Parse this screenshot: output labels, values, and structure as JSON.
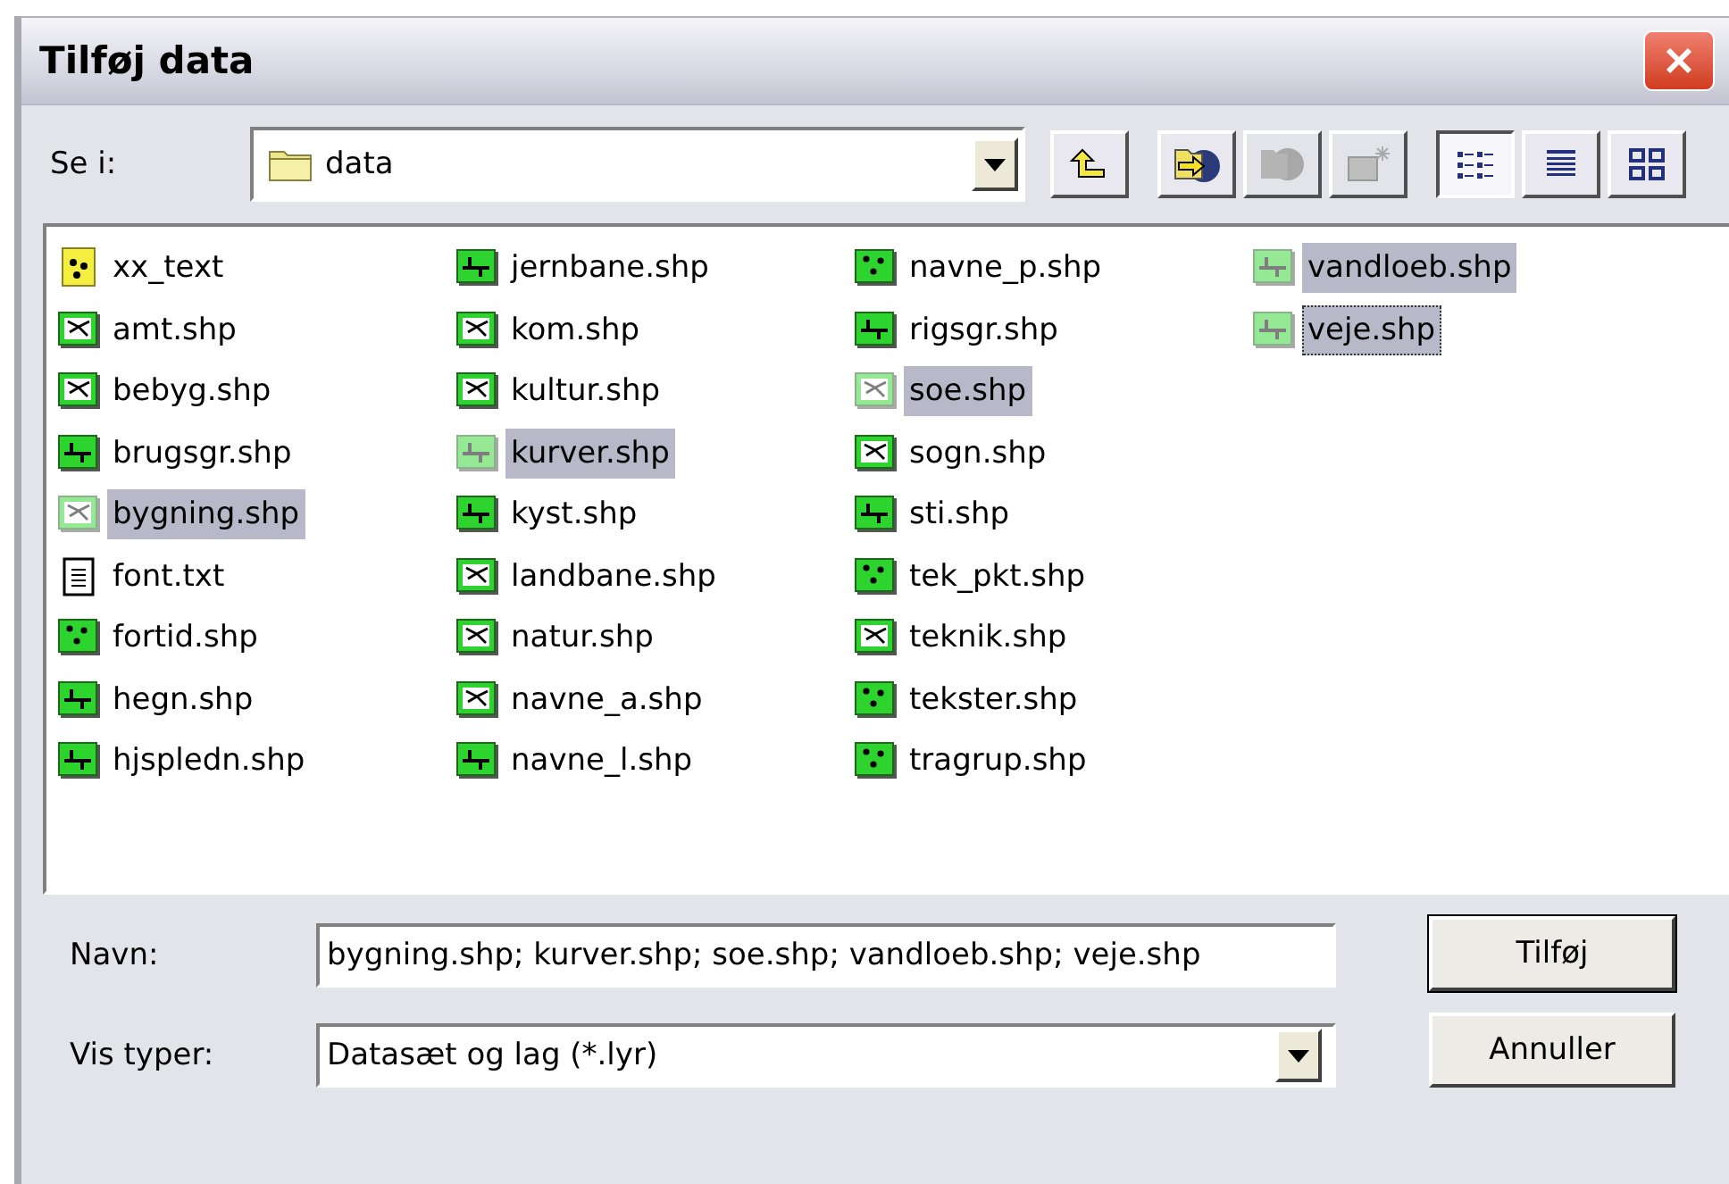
{
  "window": {
    "title": "Tilføj data"
  },
  "look_in": {
    "label": "Se i:",
    "value": "data"
  },
  "toolbar": [
    {
      "kind": "up",
      "disabled": false,
      "selected": false
    },
    {
      "kind": "connect",
      "disabled": false,
      "selected": false
    },
    {
      "kind": "disconnect",
      "disabled": true,
      "selected": false
    },
    {
      "kind": "new",
      "disabled": true,
      "selected": false
    },
    {
      "kind": "list",
      "disabled": false,
      "selected": true
    },
    {
      "kind": "details",
      "disabled": false,
      "selected": false
    },
    {
      "kind": "thumbnails",
      "disabled": false,
      "selected": false
    }
  ],
  "files": [
    {
      "name": "xx_text",
      "kind": "layer",
      "selected": false,
      "focused": false
    },
    {
      "name": "amt.shp",
      "kind": "polygon",
      "selected": false,
      "focused": false
    },
    {
      "name": "bebyg.shp",
      "kind": "polygon",
      "selected": false,
      "focused": false
    },
    {
      "name": "brugsgr.shp",
      "kind": "line",
      "selected": false,
      "focused": false
    },
    {
      "name": "bygning.shp",
      "kind": "polygon",
      "selected": true,
      "focused": false
    },
    {
      "name": "font.txt",
      "kind": "text",
      "selected": false,
      "focused": false
    },
    {
      "name": "fortid.shp",
      "kind": "point",
      "selected": false,
      "focused": false
    },
    {
      "name": "hegn.shp",
      "kind": "line",
      "selected": false,
      "focused": false
    },
    {
      "name": "hjspledn.shp",
      "kind": "line",
      "selected": false,
      "focused": false
    },
    {
      "name": "jernbane.shp",
      "kind": "line",
      "selected": false,
      "focused": false
    },
    {
      "name": "kom.shp",
      "kind": "polygon",
      "selected": false,
      "focused": false
    },
    {
      "name": "kultur.shp",
      "kind": "polygon",
      "selected": false,
      "focused": false
    },
    {
      "name": "kurver.shp",
      "kind": "line",
      "selected": true,
      "focused": false
    },
    {
      "name": "kyst.shp",
      "kind": "line",
      "selected": false,
      "focused": false
    },
    {
      "name": "landbane.shp",
      "kind": "polygon",
      "selected": false,
      "focused": false
    },
    {
      "name": "natur.shp",
      "kind": "polygon",
      "selected": false,
      "focused": false
    },
    {
      "name": "navne_a.shp",
      "kind": "polygon",
      "selected": false,
      "focused": false
    },
    {
      "name": "navne_l.shp",
      "kind": "line",
      "selected": false,
      "focused": false
    },
    {
      "name": "navne_p.shp",
      "kind": "point",
      "selected": false,
      "focused": false
    },
    {
      "name": "rigsgr.shp",
      "kind": "line",
      "selected": false,
      "focused": false
    },
    {
      "name": "soe.shp",
      "kind": "polygon",
      "selected": true,
      "focused": false
    },
    {
      "name": "sogn.shp",
      "kind": "polygon",
      "selected": false,
      "focused": false
    },
    {
      "name": "sti.shp",
      "kind": "line",
      "selected": false,
      "focused": false
    },
    {
      "name": "tek_pkt.shp",
      "kind": "point",
      "selected": false,
      "focused": false
    },
    {
      "name": "teknik.shp",
      "kind": "polygon",
      "selected": false,
      "focused": false
    },
    {
      "name": "tekster.shp",
      "kind": "point",
      "selected": false,
      "focused": false
    },
    {
      "name": "tragrup.shp",
      "kind": "point",
      "selected": false,
      "focused": false
    },
    {
      "name": "vandloeb.shp",
      "kind": "line",
      "selected": true,
      "focused": false
    },
    {
      "name": "veje.shp",
      "kind": "line",
      "selected": true,
      "focused": true
    }
  ],
  "name_field": {
    "label": "Navn:",
    "value": "bygning.shp; kurver.shp; soe.shp; vandloeb.shp; veje.shp"
  },
  "type_field": {
    "label": "Vis typer:",
    "value": "Datasæt og lag (*.lyr)"
  },
  "buttons": [
    {
      "label": "Tilføj",
      "default": true
    },
    {
      "label": "Annuller",
      "default": false
    }
  ]
}
